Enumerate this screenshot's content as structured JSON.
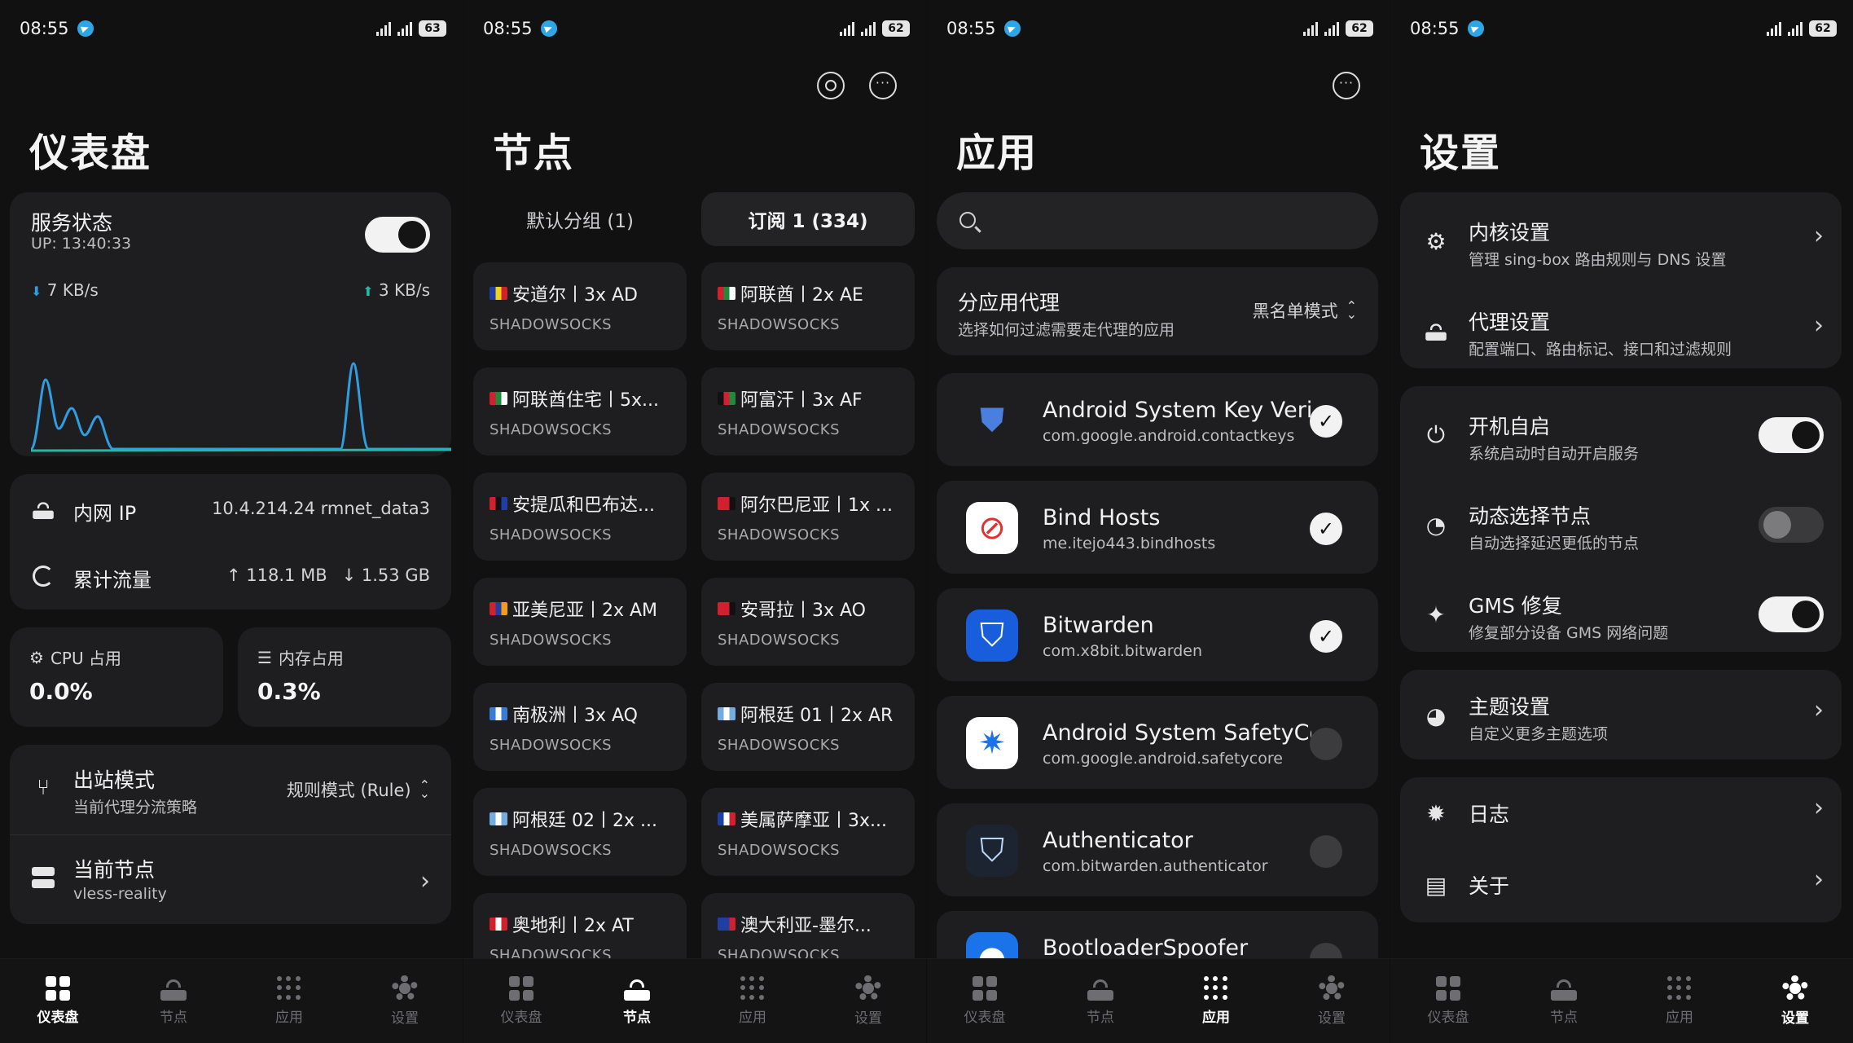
{
  "status_bar": {
    "screens": [
      {
        "time": "08:55",
        "battery": "63"
      },
      {
        "time": "08:55",
        "battery": "62"
      },
      {
        "time": "08:55",
        "battery": "62"
      },
      {
        "time": "08:55",
        "battery": "62"
      }
    ]
  },
  "nav": {
    "dashboard": "仪表盘",
    "nodes": "节点",
    "apps": "应用",
    "settings": "设置"
  },
  "dashboard": {
    "title": "仪表盘",
    "service_status_label": "服务状态",
    "uptime": "UP: 13:40:33",
    "download_speed": "7 KB/s",
    "upload_speed": "3 KB/s",
    "service_on": true,
    "lan_ip_label": "内网 IP",
    "lan_ip_value": "10.4.214.24 rmnet_data3",
    "traffic_label": "累计流量",
    "traffic_up": "↑ 118.1 MB",
    "traffic_down": "↓ 1.53 GB",
    "cpu_label": "CPU 占用",
    "cpu_value": "0.0%",
    "mem_label": "内存占用",
    "mem_value": "0.3%",
    "outbound_title": "出站模式",
    "outbound_sub": "当前代理分流策略",
    "outbound_value": "规则模式 (Rule)",
    "current_node_title": "当前节点",
    "current_node_sub": "vless-reality",
    "colors": {
      "accent": "#27b8a2",
      "download": "#2f9ee0"
    }
  },
  "nodes": {
    "title": "节点",
    "tabs": [
      {
        "label": "默认分组 (1)",
        "active": false
      },
      {
        "label": "订阅 1 (334)",
        "active": true
      }
    ],
    "items": [
      {
        "name": "安道尔丨3x AD",
        "type": "SHADOWSOCKS",
        "flag": [
          "#1f3fa3",
          "#f3d21a",
          "#d2202f"
        ]
      },
      {
        "name": "阿联酋丨2x AE",
        "type": "SHADOWSOCKS",
        "flag": [
          "#d2202f",
          "#1f8a3a",
          "#ffffff"
        ]
      },
      {
        "name": "阿联酋住宅丨5x...",
        "type": "SHADOWSOCKS",
        "flag": [
          "#d2202f",
          "#1f8a3a",
          "#ffffff"
        ]
      },
      {
        "name": "阿富汗丨3x AF",
        "type": "SHADOWSOCKS",
        "flag": [
          "#111111",
          "#d2202f",
          "#1f8a3a"
        ]
      },
      {
        "name": "安提瓜和巴布达...",
        "type": "SHADOWSOCKS",
        "flag": [
          "#d2202f",
          "#111111",
          "#1f3fa3"
        ]
      },
      {
        "name": "阿尔巴尼亚丨1x ...",
        "type": "SHADOWSOCKS",
        "flag": [
          "#d2202f",
          "#d2202f",
          "#111111"
        ]
      },
      {
        "name": "亚美尼亚丨2x AM",
        "type": "SHADOWSOCKS",
        "flag": [
          "#d2202f",
          "#1f3fa3",
          "#f39a1a"
        ]
      },
      {
        "name": "安哥拉丨3x AO",
        "type": "SHADOWSOCKS",
        "flag": [
          "#d2202f",
          "#d2202f",
          "#111111"
        ]
      },
      {
        "name": "南极洲丨3x AQ",
        "type": "SHADOWSOCKS",
        "flag": [
          "#3a7bd5",
          "#ffffff",
          "#3a7bd5"
        ]
      },
      {
        "name": "阿根廷 01丨2x AR",
        "type": "SHADOWSOCKS",
        "flag": [
          "#74acdf",
          "#ffffff",
          "#74acdf"
        ]
      },
      {
        "name": "阿根廷 02丨2x ...",
        "type": "SHADOWSOCKS",
        "flag": [
          "#74acdf",
          "#ffffff",
          "#74acdf"
        ]
      },
      {
        "name": "美属萨摩亚丨3x...",
        "type": "SHADOWSOCKS",
        "flag": [
          "#1f3fa3",
          "#ffffff",
          "#d2202f"
        ]
      },
      {
        "name": "奥地利丨2x AT",
        "type": "SHADOWSOCKS",
        "flag": [
          "#d2202f",
          "#ffffff",
          "#d2202f"
        ]
      },
      {
        "name": "澳大利亚-墨尔...",
        "type": "SHADOWSOCKS",
        "flag": [
          "#1f3fa3",
          "#1f3fa3",
          "#d2202f"
        ]
      }
    ]
  },
  "apps": {
    "title": "应用",
    "search_placeholder": "",
    "per_app_title": "分应用代理",
    "per_app_sub": "选择如何过滤需要走代理的应用",
    "per_app_mode": "黑名单模式",
    "items": [
      {
        "name": "Android System Key Verif",
        "package": "com.google.android.contactkeys",
        "checked": true,
        "icon": "shield-icon",
        "icon_bg": "#1e1e20",
        "icon_fg": "#4a7fe0"
      },
      {
        "name": "Bind Hosts",
        "package": "me.itejo443.bindhosts",
        "checked": true,
        "icon": "block-icon",
        "icon_bg": "#ffffff",
        "icon_fg": "#e03030"
      },
      {
        "name": "Bitwarden",
        "package": "com.x8bit.bitwarden",
        "checked": true,
        "icon": "bitwarden-shield-icon",
        "icon_bg": "#175ddc",
        "icon_fg": "#ffffff"
      },
      {
        "name": "Android System SafetyCo",
        "package": "com.google.android.safetycore",
        "checked": false,
        "icon": "gear-shield-icon",
        "icon_bg": "#ffffff",
        "icon_fg": "#1a73e8"
      },
      {
        "name": "Authenticator",
        "package": "com.bitwarden.authenticator",
        "checked": false,
        "icon": "authenticator-icon",
        "icon_bg": "#1b2430",
        "icon_fg": "#bcd6f5"
      },
      {
        "name": "BootloaderSpoofer",
        "package": "",
        "checked": false,
        "icon": "android-icon",
        "icon_bg": "#1a73e8",
        "icon_fg": "#ffffff"
      }
    ]
  },
  "settings": {
    "title": "设置",
    "kernel_title": "内核设置",
    "kernel_sub": "管理 sing-box 路由规则与 DNS 设置",
    "proxy_title": "代理设置",
    "proxy_sub": "配置端口、路由标记、接口和过滤规则",
    "autostart_title": "开机自启",
    "autostart_sub": "系统启动时自动开启服务",
    "autostart_on": true,
    "dynamic_title": "动态选择节点",
    "dynamic_sub": "自动选择延迟更低的节点",
    "dynamic_on": false,
    "gms_title": "GMS 修复",
    "gms_sub": "修复部分设备 GMS 网络问题",
    "gms_on": true,
    "theme_title": "主题设置",
    "theme_sub": "自定义更多主题选项",
    "logs_title": "日志",
    "about_title": "关于"
  }
}
